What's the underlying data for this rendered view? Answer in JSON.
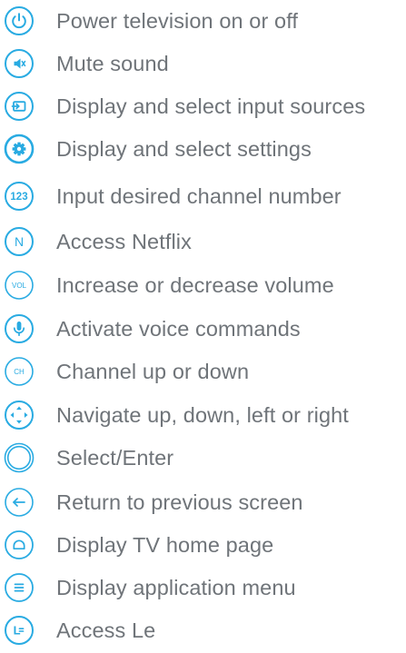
{
  "accent_color": "#29abe2",
  "text_color": "#6f7479",
  "items": [
    {
      "icon": "power-icon",
      "label": "Power television on or off"
    },
    {
      "icon": "mute-icon",
      "label": "Mute sound"
    },
    {
      "icon": "input-icon",
      "label": "Display and select input sources"
    },
    {
      "icon": "settings-icon",
      "label": "Display and select settings"
    },
    {
      "icon": "number-pad-icon",
      "icon_text": "123",
      "label": "Input desired channel number"
    },
    {
      "icon": "netflix-icon",
      "icon_text": "N",
      "label": "Access Netflix"
    },
    {
      "icon": "volume-icon",
      "icon_text": "VOL",
      "label": "Increase or decrease volume"
    },
    {
      "icon": "microphone-icon",
      "label": "Activate voice commands"
    },
    {
      "icon": "channel-icon",
      "icon_text": "CH",
      "label": "Channel up or down"
    },
    {
      "icon": "navigation-pad-icon",
      "label": "Navigate up, down, left or right"
    },
    {
      "icon": "select-enter-icon",
      "label": "Select/Enter"
    },
    {
      "icon": "back-arrow-icon",
      "label": "Return to previous screen"
    },
    {
      "icon": "home-icon",
      "label": "Display TV home page"
    },
    {
      "icon": "menu-icon",
      "label": "Display application menu"
    },
    {
      "icon": "le-icon",
      "icon_text": "L",
      "label": "Access Le"
    }
  ]
}
